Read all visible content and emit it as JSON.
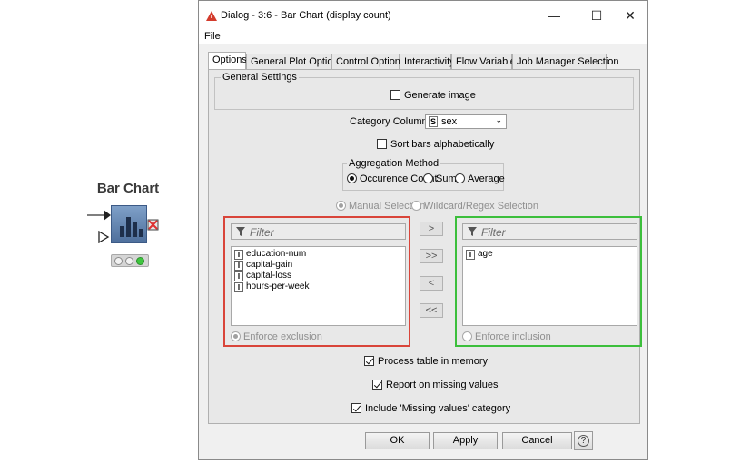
{
  "node": {
    "title": "Bar Chart",
    "icon": "bar-chart-icon",
    "status_lights": [
      "gray",
      "gray",
      "green"
    ]
  },
  "dialog": {
    "title": "Dialog - 3:6 - Bar Chart (display count)",
    "menu": {
      "file": "File"
    },
    "tabs": [
      {
        "label": "Options",
        "active": true
      },
      {
        "label": "General Plot Options",
        "active": false
      },
      {
        "label": "Control Options",
        "active": false
      },
      {
        "label": "Interactivity",
        "active": false
      },
      {
        "label": "Flow Variables",
        "active": false
      },
      {
        "label": "Job Manager Selection",
        "active": false
      }
    ],
    "general_settings": {
      "legend": "General Settings",
      "generate_image_label": "Generate image",
      "generate_image_checked": false
    },
    "category_column": {
      "label": "Category Column",
      "type_badge": "S",
      "value": "sex"
    },
    "sort_bars": {
      "label": "Sort bars alphabetically",
      "checked": false
    },
    "aggregation": {
      "legend": "Aggregation Method",
      "options": [
        {
          "label": "Occurence Count",
          "selected": true
        },
        {
          "label": "Sum",
          "selected": false
        },
        {
          "label": "Average",
          "selected": false
        }
      ]
    },
    "selection_mode": {
      "manual": "Manual Selection",
      "wildcard": "Wildcard/Regex Selection"
    },
    "exclude": {
      "filter_placeholder": "Filter",
      "items": [
        {
          "badge": "I",
          "name": "education-num"
        },
        {
          "badge": "I",
          "name": "capital-gain"
        },
        {
          "badge": "I",
          "name": "capital-loss"
        },
        {
          "badge": "I",
          "name": "hours-per-week"
        }
      ],
      "enforce_label": "Enforce exclusion"
    },
    "include": {
      "filter_placeholder": "Filter",
      "items": [
        {
          "badge": "I",
          "name": "age"
        }
      ],
      "enforce_label": "Enforce inclusion"
    },
    "move_buttons": {
      "add": ">",
      "add_all": ">>",
      "remove": "<",
      "remove_all": "<<"
    },
    "process_in_memory": {
      "label": "Process table in memory",
      "checked": true
    },
    "report_missing": {
      "label": "Report on missing values",
      "checked": true
    },
    "include_missing": {
      "label": "Include 'Missing values' category",
      "checked": true
    },
    "buttons": {
      "ok": "OK",
      "apply": "Apply",
      "cancel": "Cancel",
      "help": "?"
    },
    "colors": {
      "exclude_highlight": "#d9453a",
      "include_highlight": "#3cbf3c",
      "title_icon": "#d33b2c"
    }
  }
}
